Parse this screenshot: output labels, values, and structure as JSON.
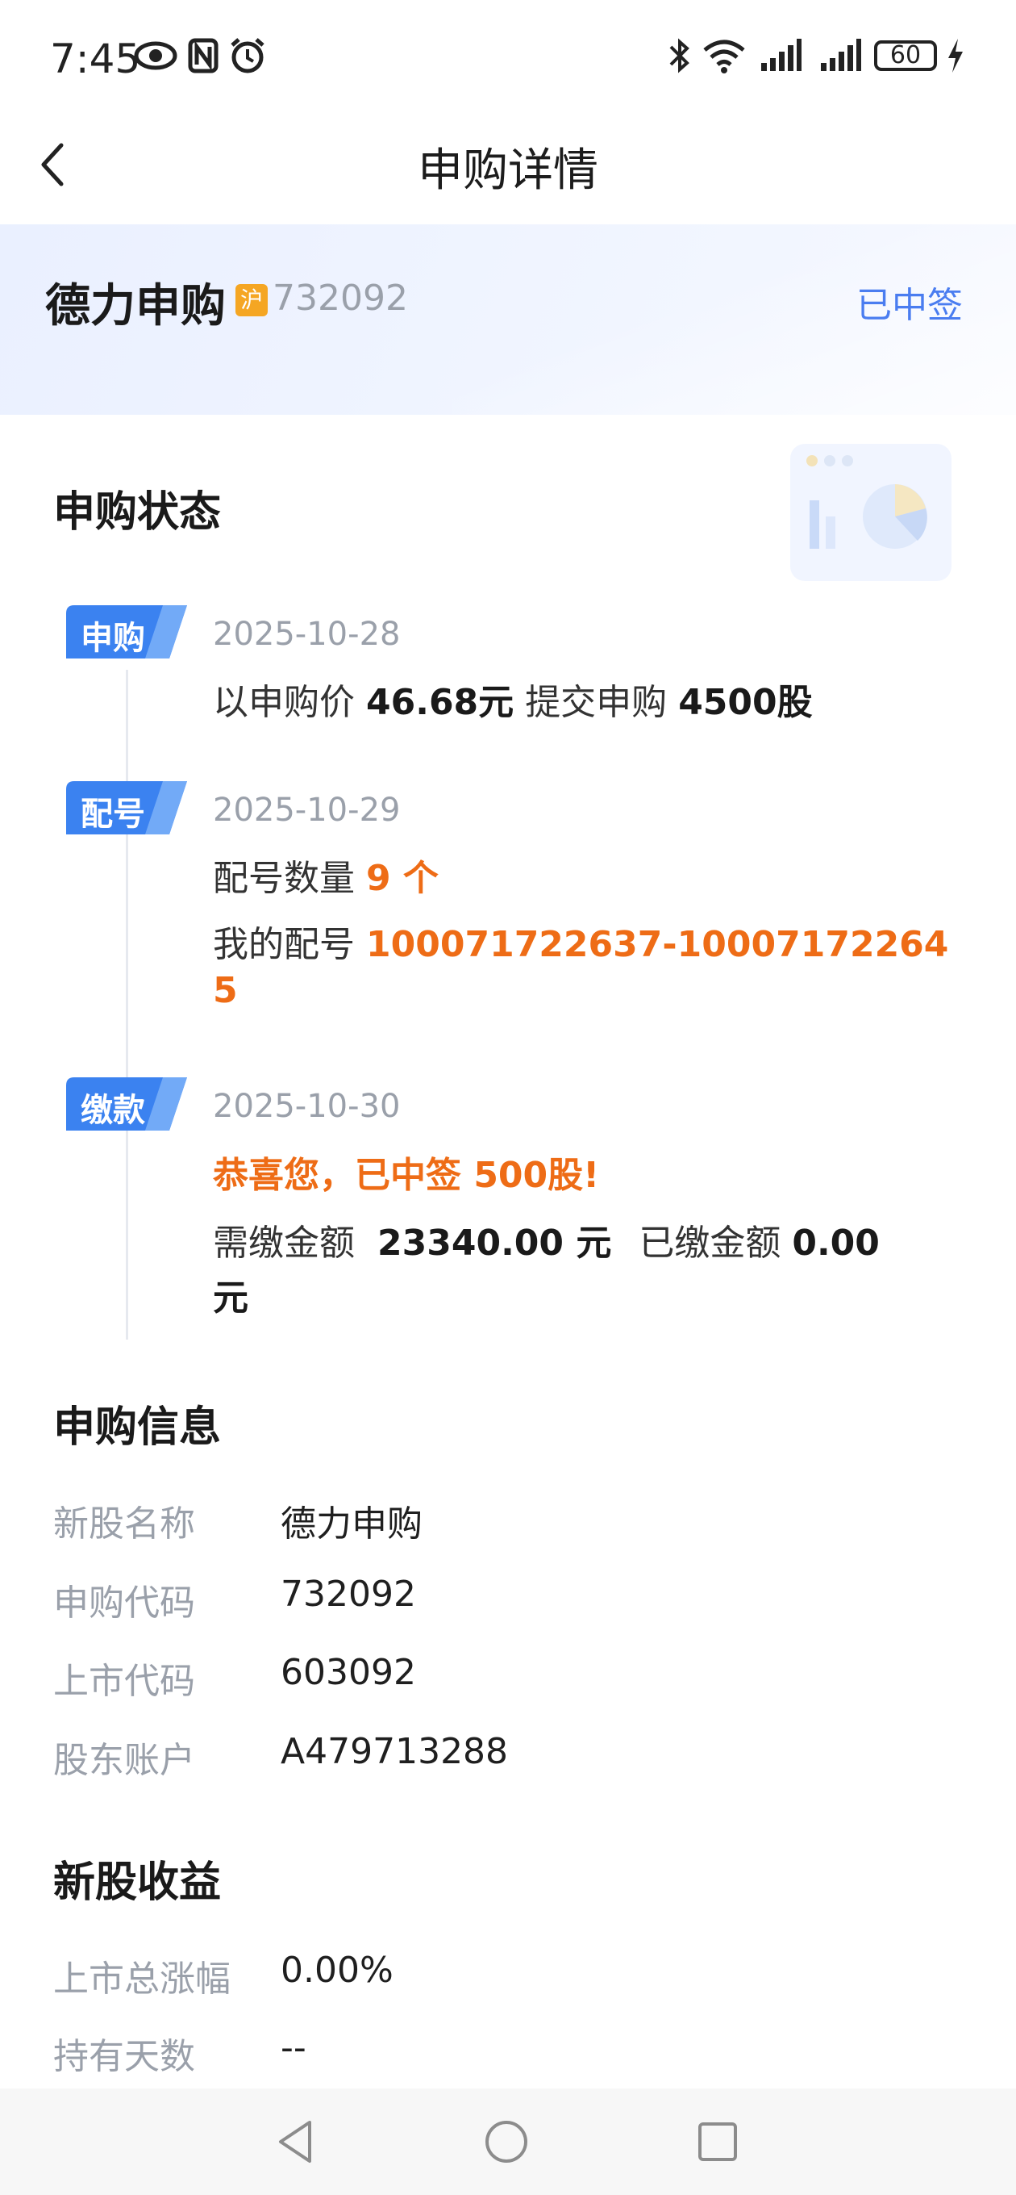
{
  "status_bar": {
    "time": "7:45",
    "battery": "60"
  },
  "header": {
    "title": "申购详情"
  },
  "stock": {
    "name": "德力申购",
    "market_badge": "沪",
    "code": "732092",
    "result": "已中签"
  },
  "status_section": {
    "title": "申购状态",
    "steps": [
      {
        "tag": "申购",
        "date": "2025-10-28",
        "line1_a": "以申购价",
        "line1_b": "46.68元",
        "line1_c": "提交申购",
        "line1_d": "4500股"
      },
      {
        "tag": "配号",
        "date": "2025-10-29",
        "count_label": "配号数量",
        "count_value": "9 个",
        "range_label": "我的配号",
        "range_value": "100071722637-10007172264",
        "range_value_wrap": "5"
      },
      {
        "tag": "缴款",
        "date": "2025-10-30",
        "congrats": "恭喜您，已中签 500股!",
        "due_label": "需缴金额",
        "due_value": "23340.00 元",
        "paid_label": "已缴金额",
        "paid_value": "0.00",
        "paid_unit": "元"
      }
    ]
  },
  "info_section": {
    "title": "申购信息",
    "rows": [
      {
        "label": "新股名称",
        "value": "德力申购"
      },
      {
        "label": "申购代码",
        "value": "732092"
      },
      {
        "label": "上市代码",
        "value": "603092"
      },
      {
        "label": "股东账户",
        "value": "A479713288"
      }
    ]
  },
  "profit_section": {
    "title": "新股收益",
    "rows": [
      {
        "label": "上市总涨幅",
        "value": "0.00%"
      },
      {
        "label": "持有天数",
        "value": "--"
      }
    ]
  }
}
